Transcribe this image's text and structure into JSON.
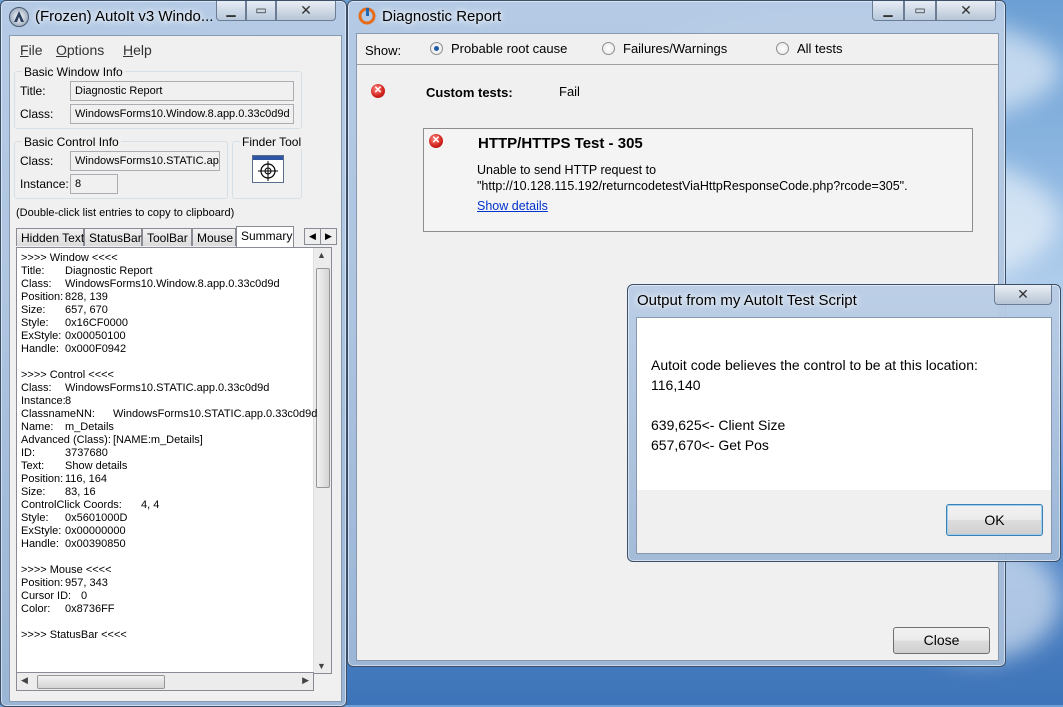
{
  "autoit": {
    "title": "(Frozen) AutoIt v3 Windo...",
    "menu": [
      {
        "label": "File",
        "u": "F",
        "rest": "ile"
      },
      {
        "label": "Options",
        "u": "O",
        "rest": "ptions"
      },
      {
        "label": "Help",
        "u": "H",
        "rest": "elp"
      }
    ],
    "basic_window_info": {
      "label": "Basic Window Info",
      "title_label": "Title:",
      "title_value": "Diagnostic Report",
      "class_label": "Class:",
      "class_value": "WindowsForms10.Window.8.app.0.33c0d9d"
    },
    "basic_control_info": {
      "label": "Basic Control Info",
      "class_label": "Class:",
      "class_value": "WindowsForms10.STATIC.app",
      "instance_label": "Instance:",
      "instance_value": "8"
    },
    "finder_tool": "Finder Tool",
    "hint": "(Double-click list entries to copy to clipboard)",
    "tabs": [
      "Hidden Text",
      "StatusBar",
      "ToolBar",
      "Mouse",
      "Summary"
    ],
    "summary": [
      {
        "k": ">>>> Window <<<<",
        "v": ""
      },
      {
        "k": "Title:",
        "v": "Diagnostic Report"
      },
      {
        "k": "Class:",
        "v": "WindowsForms10.Window.8.app.0.33c0d9d"
      },
      {
        "k": "Position:",
        "v": "828, 139"
      },
      {
        "k": "Size:",
        "v": "657, 670"
      },
      {
        "k": "Style:",
        "v": "0x16CF0000"
      },
      {
        "k": "ExStyle:",
        "v": "0x00050100"
      },
      {
        "k": "Handle:",
        "v": "0x000F0942"
      },
      {
        "k": "",
        "v": ""
      },
      {
        "k": ">>>> Control <<<<",
        "v": ""
      },
      {
        "k": "Class:",
        "v": "WindowsForms10.STATIC.app.0.33c0d9d"
      },
      {
        "k": "Instance:",
        "v": "8"
      },
      {
        "k": "ClassnameNN:",
        "v": "WindowsForms10.STATIC.app.0.33c0d9d"
      },
      {
        "k": "Name:",
        "v": "m_Details"
      },
      {
        "k": "Advanced (Class):",
        "v": "[NAME:m_Details]"
      },
      {
        "k": "ID:",
        "v": "3737680"
      },
      {
        "k": "Text:",
        "v": "Show details"
      },
      {
        "k": "Position:",
        "v": "116, 164"
      },
      {
        "k": "Size:",
        "v": "83, 16"
      },
      {
        "k": "ControlClick Coords:",
        "v": "4, 4"
      },
      {
        "k": "Style:",
        "v": "0x5601000D"
      },
      {
        "k": "ExStyle:",
        "v": "0x00000000"
      },
      {
        "k": "Handle:",
        "v": "0x00390850"
      },
      {
        "k": "",
        "v": ""
      },
      {
        "k": ">>>> Mouse <<<<",
        "v": ""
      },
      {
        "k": "Position:",
        "v": "957, 343"
      },
      {
        "k": "Cursor ID:",
        "v": "0"
      },
      {
        "k": "Color:",
        "v": "0x8736FF"
      },
      {
        "k": "",
        "v": ""
      },
      {
        "k": ">>>> StatusBar <<<<",
        "v": ""
      }
    ]
  },
  "diag": {
    "title": "Diagnostic Report",
    "show_label": "Show:",
    "options": [
      {
        "label": "Probable root cause",
        "selected": true
      },
      {
        "label": "Failures/Warnings",
        "selected": false
      },
      {
        "label": "All tests",
        "selected": false
      }
    ],
    "custom_tests_label": "Custom tests:",
    "custom_tests_result": "Fail",
    "test": {
      "title": "HTTP/HTTPS Test - 305",
      "line1": "Unable to send HTTP request to",
      "line2": "\"http://10.128.115.192/returncodetestViaHttpResponseCode.php?rcode=305\".",
      "link": "Show details"
    },
    "close_label": "Close"
  },
  "output": {
    "title": "Output from my AutoIt Test Script",
    "line1": "Autoit code believes the control to be at this location:",
    "line2": "116,140",
    "line3": "639,625<- Client Size",
    "line4": "657,670<- Get Pos",
    "ok_label": "OK"
  },
  "icons": {
    "minimize": "minimize-icon",
    "maximize": "maximize-icon",
    "close": "close-icon",
    "error": "error-icon",
    "crosshair": "crosshair-icon"
  }
}
